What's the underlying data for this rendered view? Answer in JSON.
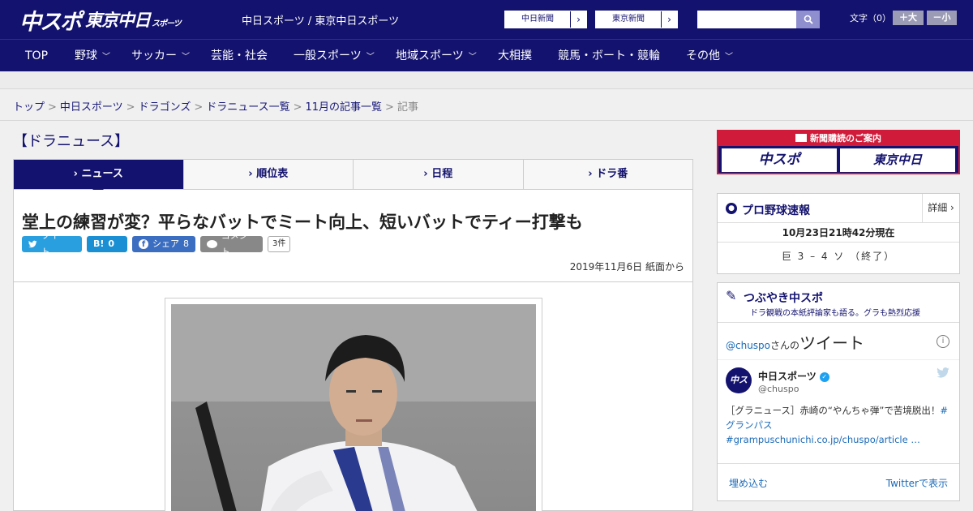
{
  "header": {
    "logo_main": "中スポ",
    "logo_sub": "東京中日",
    "logo_sub_small": "スポーツ",
    "site_name": "中日スポーツ / 東京中日スポーツ",
    "paper_links": [
      {
        "label": "中日新聞",
        "arrow": "›"
      },
      {
        "label": "東京新聞",
        "arrow": "›"
      }
    ],
    "search_placeholder": "",
    "font_size_label": "文字（0）",
    "font_large": "＋大",
    "font_small": "－小"
  },
  "nav": {
    "items": [
      {
        "label": "TOP",
        "dropdown": false
      },
      {
        "label": "野球",
        "dropdown": true
      },
      {
        "label": "サッカー",
        "dropdown": true
      },
      {
        "label": "芸能・社会",
        "dropdown": false
      },
      {
        "label": "一般スポーツ",
        "dropdown": true
      },
      {
        "label": "地域スポーツ",
        "dropdown": true
      },
      {
        "label": "大相撲",
        "dropdown": false
      },
      {
        "label": "競馬・ボート・競輪",
        "dropdown": false
      },
      {
        "label": "その他",
        "dropdown": true
      }
    ]
  },
  "breadcrumb": {
    "items": [
      "トップ",
      "中日スポーツ",
      "ドラゴンズ",
      "ドラニュース一覧",
      "11月の記事一覧"
    ],
    "current": "記事",
    "separator": ">"
  },
  "section": {
    "heading": "【ドラニュース】",
    "tabs": [
      "ニュース",
      "順位表",
      "日程",
      "ドラ番"
    ],
    "active_tab": 0
  },
  "article": {
    "headline": "堂上の練習が変？平らなバットでミート向上、短いバットでティー打撃も",
    "share": {
      "tweet": "ツイート",
      "hatena_label": "B!",
      "hatena_count": "0",
      "facebook": "シェア",
      "facebook_count": "8",
      "comment": "コメント",
      "comment_count": "3件"
    },
    "date": "2019年11月6日 紙面から"
  },
  "sidebar": {
    "subscribe": {
      "heading": "新聞購読のご案内",
      "left": "中スポ",
      "right": "東京中日"
    },
    "baseball": {
      "title": "プロ野球速報",
      "detail": "詳細 ›",
      "updated": "10月23日21時42分現在",
      "score": "巨 3 – 4 ソ （終了）"
    },
    "tweets": {
      "title": "つぶやき中スポ",
      "subtitle": "ドラ観戦の本紙評論家も語る。グラも熱烈応援",
      "handle": "@chuspo",
      "handle_suffix": "さんの",
      "tweet_word": "ツイート",
      "info": "i",
      "avatar_text": "中スポ",
      "account_name": "中日スポーツ",
      "account_user": "@chuspo",
      "text_plain": "［グラニュース］赤崎の“やんちゃ弾”で苦境脱出！",
      "text_links": "#グランパス #grampuschunichi.co.jp/chuspo/article …",
      "embed": "埋め込む",
      "view": "Twitterで表示"
    }
  },
  "colors": {
    "brand_navy": "#13126e",
    "accent_red": "#d01c3a",
    "twitter_blue": "#2a9fe0",
    "facebook_blue": "#3b6ec1"
  }
}
